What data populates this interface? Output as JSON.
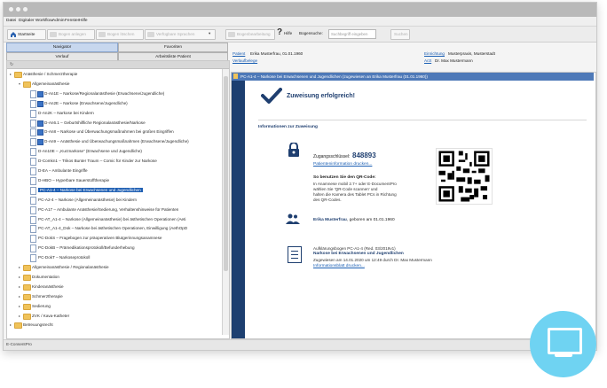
{
  "menu": [
    "Datei",
    "Digitaler Workflow",
    "Admin",
    "Fenster",
    "Hilfe"
  ],
  "toolbar": {
    "startseite": "Startseite",
    "btn_disabled_1": "Bogen anlegen",
    "btn_disabled_2": "Bogen löschen",
    "btn_disabled_3": "Verfügbare Sprachen",
    "btn_disabled_4": "Bogenbearbeitung",
    "help": "Hilfe",
    "search_label": "Bogensuche:",
    "search_placeholder": "Suchbegriff eingeben",
    "search_go": "Suchen"
  },
  "nav": {
    "navigator": "Navigator",
    "favoriten": "Favoriten",
    "verlauf": "Verlauf",
    "arbeitsliste": "Arbeitsliste Patient"
  },
  "tree": {
    "items": [
      {
        "label": "Anästhesie / Schmerztherapie",
        "level": 0,
        "kind": "folder"
      },
      {
        "label": "Allgemeinanästhesie",
        "level": 1,
        "kind": "folder"
      },
      {
        "label": "D-An1E – Narkose/Regionalanästhesie (Erwachsene/Jugendliche)",
        "level": 2,
        "kind": "doc",
        "badge": true
      },
      {
        "label": "D-An2E – Narkose (Erwachsene/Jugendliche)",
        "level": 2,
        "kind": "doc",
        "badge": true
      },
      {
        "label": "D-An2K – Narkose bei Kindern",
        "level": 2,
        "kind": "doc"
      },
      {
        "label": "D-An6.1 – Geburtshilfliche Regionalanästhesie/Narkose",
        "level": 2,
        "kind": "doc",
        "badge": true
      },
      {
        "label": "D-An8 – Narkose und Überwachungsmaßnahmen bei großen Eingriffen",
        "level": 2,
        "kind": "doc",
        "badge": true
      },
      {
        "label": "D-An9 – Anästhesie und Überwachungsmaßnahmen (Erwachsene/Jugendliche)",
        "level": 2,
        "kind": "doc",
        "badge": true
      },
      {
        "label": "D-An10E – „Kurznarkose“ (Erwachsene und Jugendliche)",
        "level": 2,
        "kind": "doc"
      },
      {
        "label": "D-Comkn1 – Trikos Bunter Traum – Comic für Kinder zur Narkose",
        "level": 2,
        "kind": "doc"
      },
      {
        "label": "D-EA – Ambulante Eingriffe",
        "level": 2,
        "kind": "doc"
      },
      {
        "label": "D-HBO – Hyperbare Sauerstofftherapie",
        "level": 2,
        "kind": "doc"
      },
      {
        "label": "PC-A1-4 – Narkose bei Erwachsenen und Jugendlichen",
        "level": 2,
        "kind": "doc",
        "selected": true
      },
      {
        "label": "PC-A2-4 – Narkose (Allgemeinanästhesie) bei Kindern",
        "level": 2,
        "kind": "doc"
      },
      {
        "label": "PC-A17 – Ambulante Anästhesie/Sedierung, Verhaltenshinweise für Patienten",
        "level": 2,
        "kind": "doc"
      },
      {
        "label": "PC-AT_A1-4 – Narkose (Allgemeinanästhesie) bei ästhetischen Operationen (Aeti",
        "level": 2,
        "kind": "doc"
      },
      {
        "label": "PC-AT_A1-4_Dok – Narkose bei ästhetischen Operationen, Einwilligung (AethOpD",
        "level": 2,
        "kind": "doc"
      },
      {
        "label": "PC-DokS – Fragebogen zur präoperativen Blutgerinnungsanamnese",
        "level": 2,
        "kind": "doc"
      },
      {
        "label": "PC-DokB – Prämedikationsprotokoll/Befunderhebung",
        "level": 2,
        "kind": "doc"
      },
      {
        "label": "PC-DokT – Narkoseprotokoll",
        "level": 2,
        "kind": "doc"
      },
      {
        "label": "Allgemeinanästhesie / Regionalanästhesie",
        "level": 1,
        "kind": "folder"
      },
      {
        "label": "Dokumentation",
        "level": 1,
        "kind": "folder"
      },
      {
        "label": "Kinderanästhesie",
        "level": 1,
        "kind": "folder"
      },
      {
        "label": "Schmerztherapie",
        "level": 1,
        "kind": "folder"
      },
      {
        "label": "Sedierung",
        "level": 1,
        "kind": "folder"
      },
      {
        "label": "ZVK / Kava-Katheter",
        "level": 1,
        "kind": "folder"
      },
      {
        "label": "Betreuungsrecht",
        "level": 0,
        "kind": "folder"
      }
    ]
  },
  "patient": {
    "patient_label": "Patient",
    "patient_value": "Erika Musterfrau, 01.01.1960",
    "verlaeufe": "Verlaufbelege",
    "einrichtung_label": "Einrichtung",
    "einrichtung_value": "Musterpraxis, Musterstadt",
    "arzt_label": "Arzt",
    "arzt_value": "Dr. Max Mustermann"
  },
  "doc_tab": "PC-A1-4 – Narkose bei Erwachsenen und Jugendlichen (zugewiesen an Erika Musterfrau (01.01.1960))",
  "content": {
    "success": "Zuweisung erfolgreich!",
    "section": "Informationen zur Zuweisung",
    "key_label": "Zugangsschlüssel:",
    "key_value": "848893",
    "patient_info_link": "Patienteninformation drucken...",
    "qr_title": "So benutzen Sie den QR-Code:",
    "qr_line1": "In Anamnese mobil 2.7+ oder E-DocumentPro",
    "qr_line2": "wählen Sie 'QR-Code scannen' und",
    "qr_line3": "halten die Kamera des Tablet PCs in Richtung",
    "qr_line4": "des QR-Codes.",
    "patient_name": "Erika Musterfrau",
    "patient_birth": ", geboren am 01.01.1960",
    "form_line1": "Aufklärungsbogen PC-A1-4 (Red. 03/2019v1)",
    "form_line2": "Narkose bei Erwachsenen und Jugendlichen",
    "form_line3": "Zugewiesen am 14.01.2020 um 12:49 durch Dr. Max Mustermann",
    "form_link": "Informationsblatt drucken..."
  },
  "status": "E-ConsentPro",
  "colors": {
    "navy": "#1f3f70",
    "accent": "#1b5fb4",
    "tab": "#4e79b8",
    "logo": "#6fd3f2"
  }
}
